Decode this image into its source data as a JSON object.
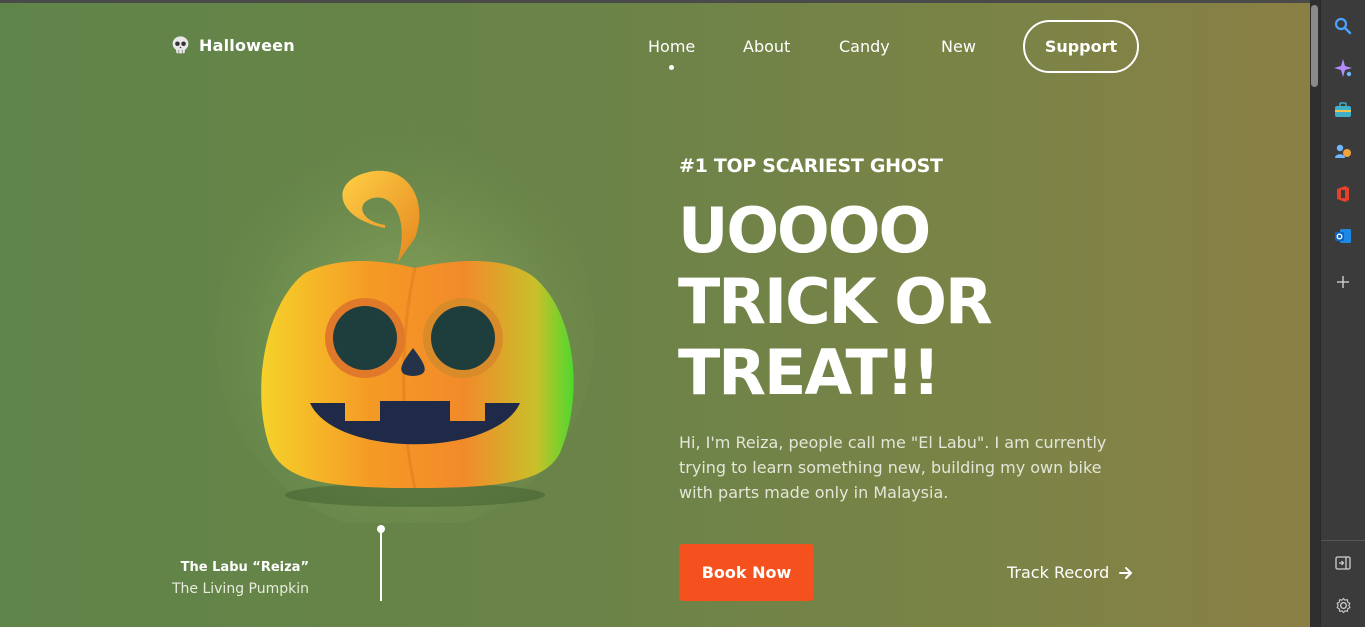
{
  "brand": {
    "name": "Halloween",
    "icon": "skull-icon"
  },
  "nav": {
    "items": [
      {
        "label": "Home",
        "active": true
      },
      {
        "label": "About"
      },
      {
        "label": "Candy"
      },
      {
        "label": "New"
      }
    ],
    "support_label": "Support"
  },
  "hero": {
    "kicker": "#1 TOP SCARIEST GHOST",
    "headline": [
      "UOOOO",
      "TRICK OR",
      "TREAT!!"
    ],
    "description": "Hi, I'm Reiza, people call me \"El Labu\". I am currently trying to learn something new, building my own bike with parts made only in Malaysia.",
    "primary_cta": "Book Now",
    "secondary_cta": "Track Record",
    "secondary_cta_icon": "arrow-right-icon"
  },
  "character": {
    "name": "The Labu “Reiza”",
    "subtitle": "The Living Pumpkin",
    "image": "pumpkin-illustration"
  },
  "browser_sidebar": {
    "icons": [
      "search-icon",
      "copilot-icon",
      "tools-icon",
      "people-icon",
      "office-icon",
      "outlook-icon",
      "add-icon",
      "split-screen-icon",
      "settings-icon"
    ]
  },
  "colors": {
    "accent": "#f4511e",
    "background_start": "#5f8449",
    "background_end": "#8a7f45",
    "text": "#ffffff"
  }
}
